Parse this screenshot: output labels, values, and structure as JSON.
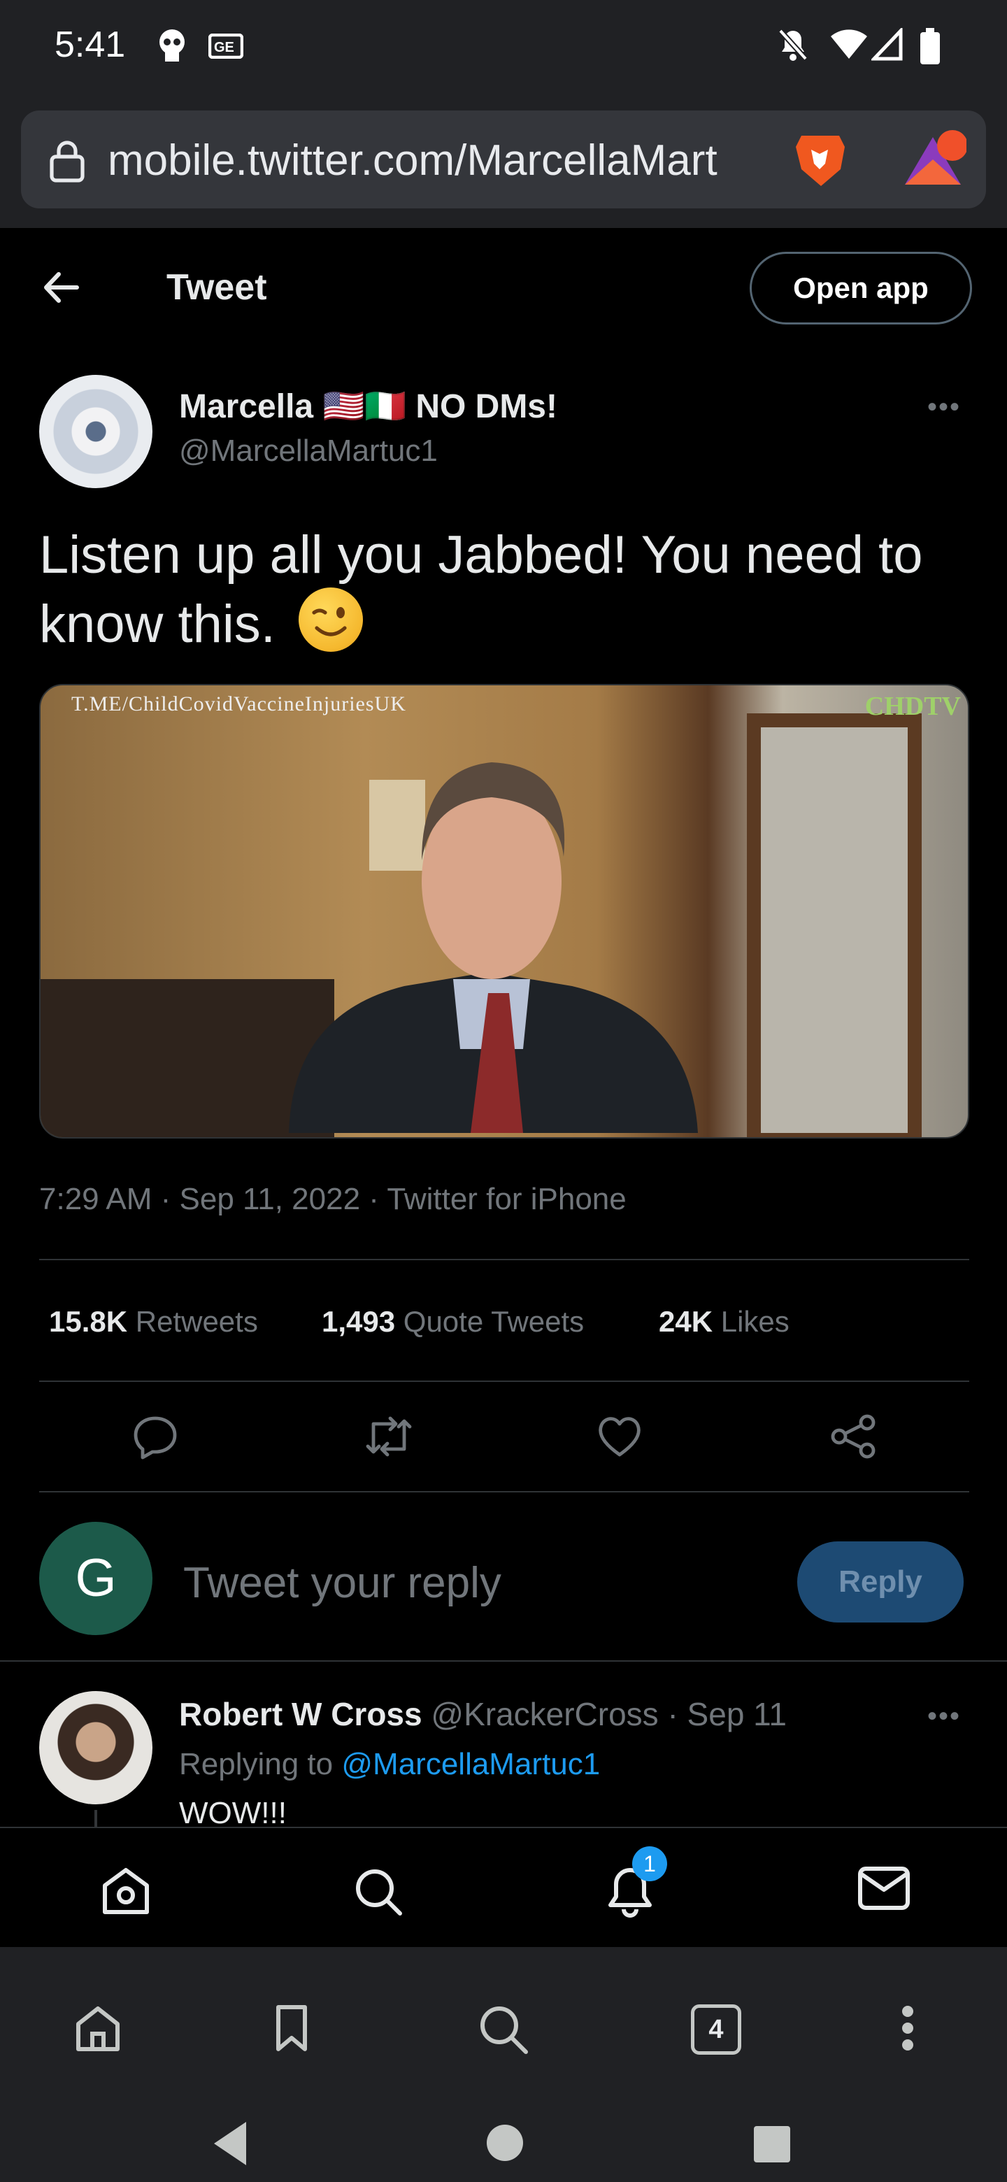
{
  "status_bar": {
    "time": "5:41"
  },
  "browser": {
    "url": "mobile.twitter.com/MarcellaMart",
    "tab_count": "4"
  },
  "header": {
    "title": "Tweet",
    "open_app_label": "Open app"
  },
  "tweet": {
    "author_name": "Marcella 🇺🇸🇮🇹 NO DMs!",
    "author_handle": "@MarcellaMartuc1",
    "text": "Listen up all you Jabbed! You need to know this.",
    "media_overlay_text": "T.ME/ChildCovidVaccineInjuriesUK",
    "media_badge": "CHDTV",
    "timestamp": "7:29 AM · Sep 11, 2022 · Twitter for iPhone",
    "stats": {
      "retweets_value": "15.8K",
      "retweets_label": "Retweets",
      "quotes_value": "1,493",
      "quotes_label": "Quote Tweets",
      "likes_value": "24K",
      "likes_label": "Likes"
    }
  },
  "reply_box": {
    "avatar_letter": "G",
    "placeholder": "Tweet your reply",
    "button_label": "Reply"
  },
  "reply": {
    "name": "Robert W Cross",
    "handle_date": "@KrackerCross · Sep 11",
    "replying_to_prefix": "Replying to",
    "replying_to_handle": "@MarcellaMartuc1",
    "text": "WOW!!!"
  },
  "bottom_nav": {
    "notification_badge": "1"
  },
  "colors": {
    "accent": "#1d9bf0",
    "background": "#000000",
    "muted": "#71767b",
    "reply_button": "#1d4a73"
  },
  "icons": [
    "back-arrow-icon",
    "lock-icon",
    "brave-lion-icon",
    "brave-rewards-icon",
    "more-icon",
    "reply-icon",
    "retweet-icon",
    "like-icon",
    "share-icon",
    "home-icon",
    "search-icon",
    "bell-icon",
    "mail-icon",
    "bookmark-icon",
    "menu-dots-icon"
  ]
}
